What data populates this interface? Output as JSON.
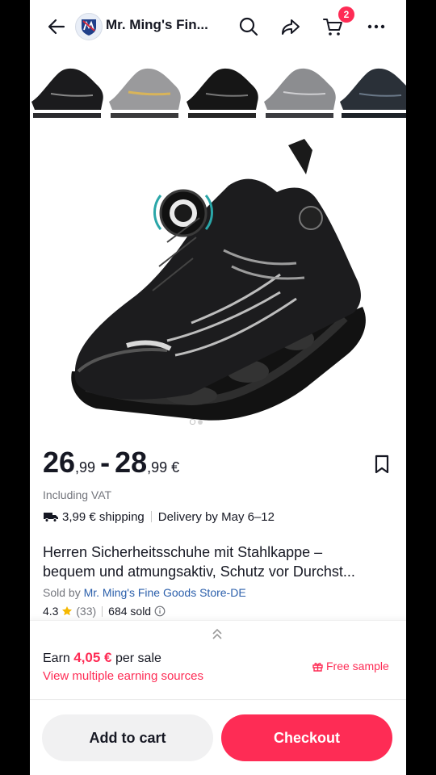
{
  "header": {
    "store_name": "Mr. Ming's Fin...",
    "cart_count": "2",
    "icons": [
      "back-arrow-icon",
      "store-logo",
      "search-icon",
      "share-icon",
      "cart-icon",
      "more-icon"
    ]
  },
  "gallery": {
    "thumbnail_count": 5,
    "thumbnail_colors": [
      "#1b1b1d",
      "#9a9a9c",
      "#161616",
      "#8c8d90",
      "#2a3038"
    ],
    "dots": 2,
    "active_dot": 0
  },
  "product": {
    "price_low_int": "26",
    "price_low_dec": ",99",
    "price_dash": "-",
    "price_high_int": "28",
    "price_high_dec": ",99 €",
    "vat": "Including VAT",
    "shipping": "3,99 € shipping",
    "delivery": "Delivery by May 6–12",
    "title_line1": "Herren Sicherheitsschuhe mit Stahlkappe –",
    "title_line2": "bequem und atmungsaktiv, Schutz vor Durchst...",
    "sold_by_label": "Sold by",
    "store_full_name": "Mr. Ming's Fine Goods Store-DE",
    "rating": "4.3",
    "review_count": "(33)",
    "sold": "684 sold"
  },
  "earn": {
    "prefix": "Earn",
    "amount": "4,05 €",
    "suffix": "per sale",
    "link": "View multiple earning sources",
    "free_sample": "Free sample"
  },
  "actions": {
    "add_to_cart": "Add to cart",
    "checkout": "Checkout"
  },
  "colors": {
    "accent": "#fe2c55",
    "link": "#2b5fab",
    "text": "#161823",
    "muted": "#73757c"
  }
}
